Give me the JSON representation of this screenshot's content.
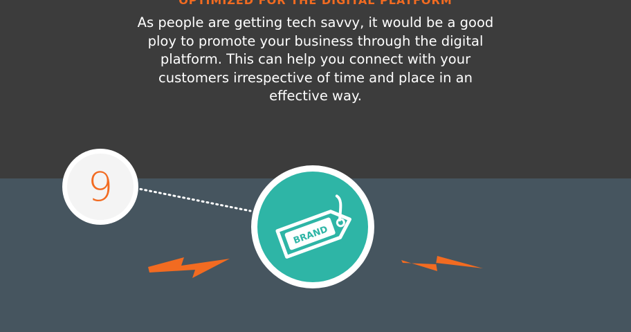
{
  "section": {
    "heading_partial": "OPTIMIZED FOR THE DIGITAL PLATFORM",
    "body_text": "As people are getting tech savvy, it would be a good\nploy to promote your business through the digital\nplatform. This can help you connect with your\ncustomers irrespective of time and place in an\neffective way."
  },
  "step": {
    "number": "9"
  },
  "brand_tag": {
    "label": "BRAND"
  },
  "colors": {
    "accent_orange": "#f26b21",
    "teal": "#2eb5a6",
    "dark_top": "#3c3c3c",
    "slate_bottom": "#46555f"
  },
  "icons": [
    "brand-tag-icon",
    "lightning-bolt-icon"
  ]
}
